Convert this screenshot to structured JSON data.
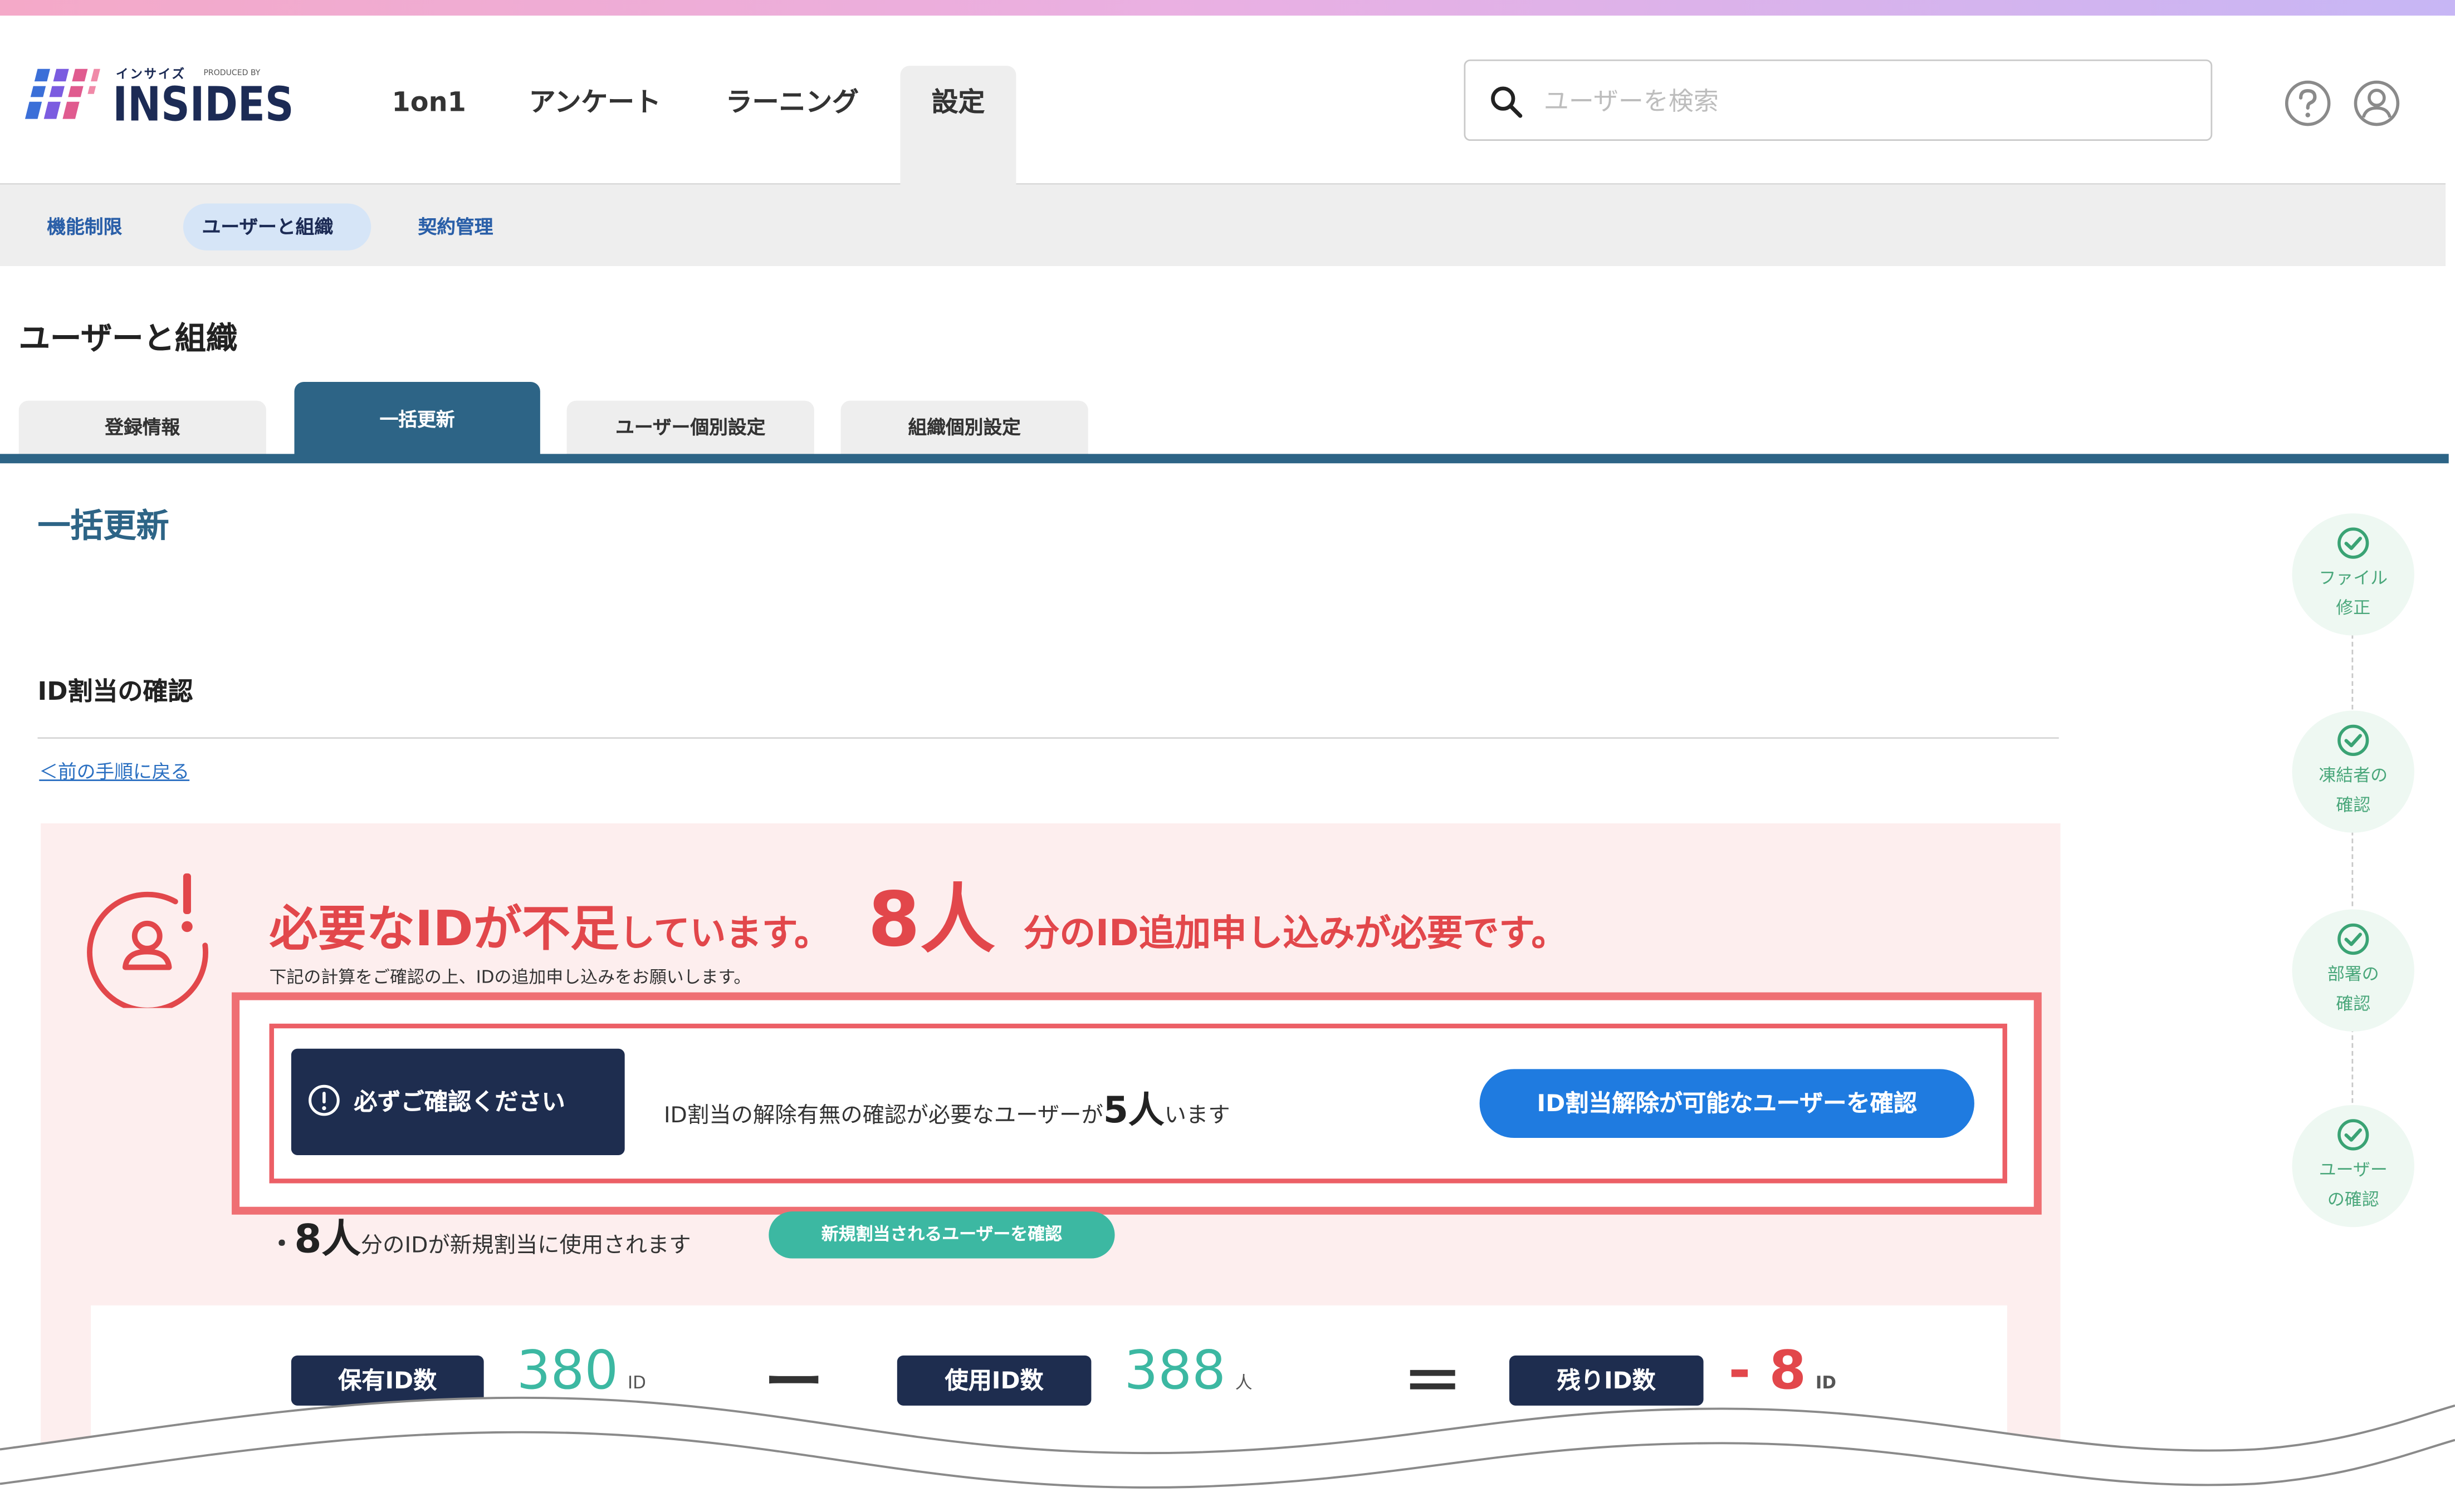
{
  "header": {
    "logo_small": "インサイズ",
    "logo_produced": "PRODUCED BY",
    "logo_text": "INSIDES",
    "nav": [
      {
        "label": "1on1"
      },
      {
        "label": "アンケート"
      },
      {
        "label": "ラーニング"
      },
      {
        "label": "設定"
      }
    ],
    "search_placeholder": "ユーザーを検索"
  },
  "subnav": [
    {
      "label": "機能制限"
    },
    {
      "label": "ユーザーと組織"
    },
    {
      "label": "契約管理"
    }
  ],
  "page_title": "ユーザーと組織",
  "tabs": [
    {
      "label": "登録情報"
    },
    {
      "label": "一括更新"
    },
    {
      "label": "ユーザー個別設定"
    },
    {
      "label": "組織個別設定"
    }
  ],
  "section_title": "一括更新",
  "step_title": "ID割当の確認",
  "back_link": "＜前の手順に戻る",
  "stepper": [
    {
      "label": "ファイル\n修正"
    },
    {
      "label": "凍結者の\n確認"
    },
    {
      "label": "部署の\n確認"
    },
    {
      "label": "ユーザー\nの確認"
    }
  ],
  "alert": {
    "heading_part1": "必要なIDが不足",
    "heading_part2": "しています。",
    "heading_count": "8人",
    "heading_part3": "分のID追加申し込みが必要です。",
    "sub": "下記の計算をご確認の上、IDの追加申し込みをお願いします。",
    "confirm_badge": "必ずご確認ください",
    "confirm_msg_pre": "ID割当の解除有無の確認が必要なユーザーが",
    "confirm_count": "5人",
    "confirm_msg_post": "います",
    "confirm_button": "ID割当解除が可能なユーザーを確認",
    "newassign_bullet": "・",
    "newassign_count": "8人",
    "newassign_text": "分のIDが新規割当に使用されます",
    "newassign_button": "新規割当されるユーザーを確認"
  },
  "calc": {
    "owned_label": "保有ID数",
    "owned_value": "380",
    "owned_unit": "ID",
    "minus": "ー",
    "used_label": "使用ID数",
    "used_value": "388",
    "used_unit": "人",
    "equals": "＝",
    "remaining_label": "残りID数",
    "remaining_value": "- 8",
    "remaining_unit": "ID"
  },
  "colors": {
    "navy": "#1e2d4f",
    "tab_active": "#2d6486",
    "alert_red": "#e2474b",
    "primary_blue": "#1f7be0",
    "teal": "#3cb8a2",
    "step_green": "#4aa77b"
  }
}
